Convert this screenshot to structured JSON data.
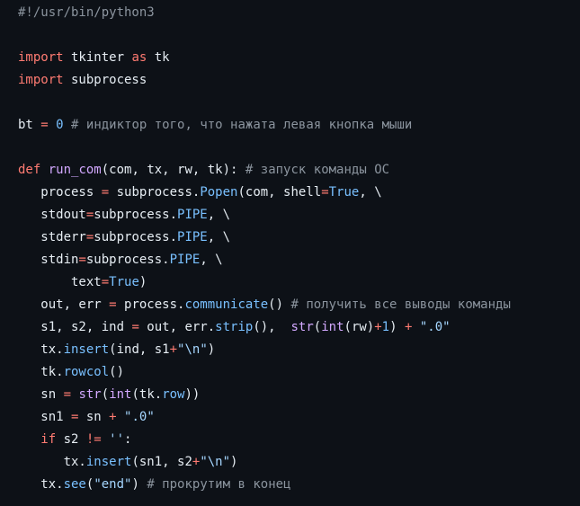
{
  "code": {
    "lines": [
      [
        {
          "t": "#!/usr/bin/python3",
          "c": "comment"
        }
      ],
      [],
      [
        {
          "t": "import",
          "c": "kw"
        },
        {
          "t": " tkinter ",
          "c": "plain"
        },
        {
          "t": "as",
          "c": "kw"
        },
        {
          "t": " tk",
          "c": "plain"
        }
      ],
      [
        {
          "t": "import",
          "c": "kw"
        },
        {
          "t": " subprocess",
          "c": "plain"
        }
      ],
      [],
      [
        {
          "t": "bt ",
          "c": "plain"
        },
        {
          "t": "=",
          "c": "op"
        },
        {
          "t": " ",
          "c": "plain"
        },
        {
          "t": "0",
          "c": "num"
        },
        {
          "t": " # индиктор того, что нажата левая кнопка мыши",
          "c": "comment"
        }
      ],
      [],
      [
        {
          "t": "def",
          "c": "kw"
        },
        {
          "t": " ",
          "c": "plain"
        },
        {
          "t": "run_com",
          "c": "fn"
        },
        {
          "t": "(com, tx, rw, tk): ",
          "c": "plain"
        },
        {
          "t": "# запуск команды ОС",
          "c": "comment"
        }
      ],
      [
        {
          "t": "   process ",
          "c": "plain"
        },
        {
          "t": "=",
          "c": "op"
        },
        {
          "t": " subprocess.",
          "c": "plain"
        },
        {
          "t": "Popen",
          "c": "attr"
        },
        {
          "t": "(com, shell",
          "c": "plain"
        },
        {
          "t": "=",
          "c": "op"
        },
        {
          "t": "True",
          "c": "const"
        },
        {
          "t": ", \\",
          "c": "plain"
        }
      ],
      [
        {
          "t": "   stdout",
          "c": "plain"
        },
        {
          "t": "=",
          "c": "op"
        },
        {
          "t": "subprocess.",
          "c": "plain"
        },
        {
          "t": "PIPE",
          "c": "attr"
        },
        {
          "t": ", \\",
          "c": "plain"
        }
      ],
      [
        {
          "t": "   stderr",
          "c": "plain"
        },
        {
          "t": "=",
          "c": "op"
        },
        {
          "t": "subprocess.",
          "c": "plain"
        },
        {
          "t": "PIPE",
          "c": "attr"
        },
        {
          "t": ", \\",
          "c": "plain"
        }
      ],
      [
        {
          "t": "   stdin",
          "c": "plain"
        },
        {
          "t": "=",
          "c": "op"
        },
        {
          "t": "subprocess.",
          "c": "plain"
        },
        {
          "t": "PIPE",
          "c": "attr"
        },
        {
          "t": ", \\",
          "c": "plain"
        }
      ],
      [
        {
          "t": "       text",
          "c": "plain"
        },
        {
          "t": "=",
          "c": "op"
        },
        {
          "t": "True",
          "c": "const"
        },
        {
          "t": ")",
          "c": "plain"
        }
      ],
      [
        {
          "t": "   out, err ",
          "c": "plain"
        },
        {
          "t": "=",
          "c": "op"
        },
        {
          "t": " process.",
          "c": "plain"
        },
        {
          "t": "communicate",
          "c": "attr"
        },
        {
          "t": "() ",
          "c": "plain"
        },
        {
          "t": "# получить все выводы команды",
          "c": "comment"
        }
      ],
      [
        {
          "t": "   s1, s2, ind ",
          "c": "plain"
        },
        {
          "t": "=",
          "c": "op"
        },
        {
          "t": " out, err.",
          "c": "plain"
        },
        {
          "t": "strip",
          "c": "attr"
        },
        {
          "t": "(),  ",
          "c": "plain"
        },
        {
          "t": "str",
          "c": "fn"
        },
        {
          "t": "(",
          "c": "plain"
        },
        {
          "t": "int",
          "c": "fn"
        },
        {
          "t": "(rw)",
          "c": "plain"
        },
        {
          "t": "+",
          "c": "op"
        },
        {
          "t": "1",
          "c": "num"
        },
        {
          "t": ") ",
          "c": "plain"
        },
        {
          "t": "+",
          "c": "op"
        },
        {
          "t": " ",
          "c": "plain"
        },
        {
          "t": "\".0\"",
          "c": "str"
        }
      ],
      [
        {
          "t": "   tx.",
          "c": "plain"
        },
        {
          "t": "insert",
          "c": "attr"
        },
        {
          "t": "(ind, s1",
          "c": "plain"
        },
        {
          "t": "+",
          "c": "op"
        },
        {
          "t": "\"\\n\"",
          "c": "str"
        },
        {
          "t": ")",
          "c": "plain"
        }
      ],
      [
        {
          "t": "   tk.",
          "c": "plain"
        },
        {
          "t": "rowcol",
          "c": "attr"
        },
        {
          "t": "()",
          "c": "plain"
        }
      ],
      [
        {
          "t": "   sn ",
          "c": "plain"
        },
        {
          "t": "=",
          "c": "op"
        },
        {
          "t": " ",
          "c": "plain"
        },
        {
          "t": "str",
          "c": "fn"
        },
        {
          "t": "(",
          "c": "plain"
        },
        {
          "t": "int",
          "c": "fn"
        },
        {
          "t": "(tk.",
          "c": "plain"
        },
        {
          "t": "row",
          "c": "attr"
        },
        {
          "t": "))",
          "c": "plain"
        }
      ],
      [
        {
          "t": "   sn1 ",
          "c": "plain"
        },
        {
          "t": "=",
          "c": "op"
        },
        {
          "t": " sn ",
          "c": "plain"
        },
        {
          "t": "+",
          "c": "op"
        },
        {
          "t": " ",
          "c": "plain"
        },
        {
          "t": "\".0\"",
          "c": "str"
        }
      ],
      [
        {
          "t": "   ",
          "c": "plain"
        },
        {
          "t": "if",
          "c": "kw"
        },
        {
          "t": " s2 ",
          "c": "plain"
        },
        {
          "t": "!=",
          "c": "op"
        },
        {
          "t": " ",
          "c": "plain"
        },
        {
          "t": "''",
          "c": "str"
        },
        {
          "t": ":",
          "c": "plain"
        }
      ],
      [
        {
          "t": "      tx.",
          "c": "plain"
        },
        {
          "t": "insert",
          "c": "attr"
        },
        {
          "t": "(sn1, s2",
          "c": "plain"
        },
        {
          "t": "+",
          "c": "op"
        },
        {
          "t": "\"\\n\"",
          "c": "str"
        },
        {
          "t": ")",
          "c": "plain"
        }
      ],
      [
        {
          "t": "   tx.",
          "c": "plain"
        },
        {
          "t": "see",
          "c": "attr"
        },
        {
          "t": "(",
          "c": "plain"
        },
        {
          "t": "\"end\"",
          "c": "str"
        },
        {
          "t": ") ",
          "c": "plain"
        },
        {
          "t": "# прокрутим в конец",
          "c": "comment"
        }
      ]
    ]
  },
  "colors": {
    "background": "#0d1117",
    "keyword": "#ff7b72",
    "function": "#d2a8ff",
    "attribute": "#79c0ff",
    "string": "#a5d6ff",
    "comment": "#8b949e",
    "text": "#e6edf3"
  }
}
